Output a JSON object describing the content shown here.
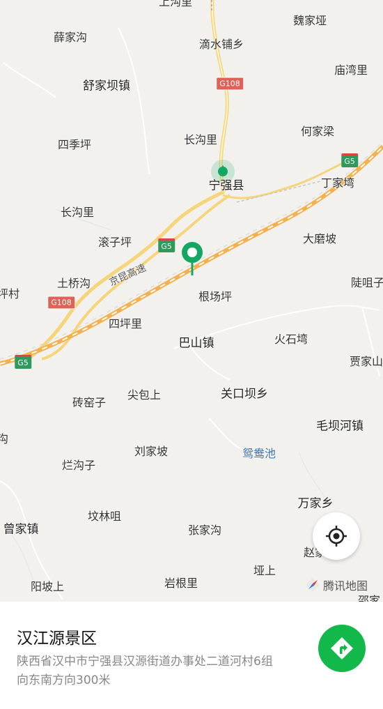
{
  "map": {
    "place_labels": [
      {
        "id": "shanggouli",
        "text": "上沟里"
      },
      {
        "id": "weijiaya",
        "text": "魏家垭"
      },
      {
        "id": "xuejiagou",
        "text": "薛家沟"
      },
      {
        "id": "dishuipu",
        "text": "滴水铺乡"
      },
      {
        "id": "miaowanli",
        "text": "庙湾里"
      },
      {
        "id": "shujiaba",
        "text": "舒家坝镇"
      },
      {
        "id": "hejialiang",
        "text": "何家梁"
      },
      {
        "id": "sijiping",
        "text": "四季坪"
      },
      {
        "id": "changgouli1",
        "text": "长沟里"
      },
      {
        "id": "ningqiang",
        "text": "宁强县"
      },
      {
        "id": "dingjiawan",
        "text": "丁家塆"
      },
      {
        "id": "changgouli2",
        "text": "长沟里"
      },
      {
        "id": "damopo",
        "text": "大磨坡"
      },
      {
        "id": "gunziping",
        "text": "滚子坪"
      },
      {
        "id": "tuqiaogou",
        "text": "土桥沟"
      },
      {
        "id": "pingcun",
        "text": "坪村"
      },
      {
        "id": "genchangping",
        "text": "根场坪"
      },
      {
        "id": "douzuzi",
        "text": "陡咀子"
      },
      {
        "id": "sipingli",
        "text": "四坪里"
      },
      {
        "id": "bashanzhen",
        "text": "巴山镇"
      },
      {
        "id": "huoshiwan",
        "text": "火石塆"
      },
      {
        "id": "jiajiashan",
        "text": "贾家山"
      },
      {
        "id": "zhuanyaozi",
        "text": "砖窑子"
      },
      {
        "id": "jianbaoshang",
        "text": "尖包上"
      },
      {
        "id": "guankouba",
        "text": "关口坝乡"
      },
      {
        "id": "gou",
        "text": "沟"
      },
      {
        "id": "maobahe",
        "text": "毛坝河镇"
      },
      {
        "id": "liujiapo",
        "text": "刘家坡"
      },
      {
        "id": "yuanyangchi",
        "text": "鸳鸯池"
      },
      {
        "id": "langouzi",
        "text": "烂沟子"
      },
      {
        "id": "wanjiaxiang",
        "text": "万家乡"
      },
      {
        "id": "fenlinju",
        "text": "坟林咀"
      },
      {
        "id": "zengjiazhen",
        "text": "曾家镇"
      },
      {
        "id": "zhangjiagou",
        "text": "张家沟"
      },
      {
        "id": "zhao",
        "text": "赵家"
      },
      {
        "id": "yashang",
        "text": "垭上"
      },
      {
        "id": "yangposhang",
        "text": "阳坡上"
      },
      {
        "id": "yangenli",
        "text": "岩根里"
      },
      {
        "id": "shaojia",
        "text": "邵家"
      }
    ],
    "road_shields": [
      {
        "id": "g108_top",
        "text": "G108"
      },
      {
        "id": "g5_right",
        "text": "G5"
      },
      {
        "id": "g5_mid",
        "text": "G5"
      },
      {
        "id": "g108_left",
        "text": "G108"
      },
      {
        "id": "g5_left",
        "text": "G5"
      }
    ],
    "highway_name": "京昆高速",
    "brand": "腾讯地图",
    "colors": {
      "land": "#f2f1ee",
      "road_yellow": "#f6d47a",
      "highway": "#f3b24e",
      "marker": "#12a864",
      "nav_button": "#12b94a"
    }
  },
  "poi": {
    "name": "汉江源景区",
    "address": "陕西省汉中市宁强县汉源街道办事处二道河村6组向东南方向300米"
  },
  "buttons": {
    "locate_icon": "crosshair-icon",
    "navigate_icon": "route-arrow-icon"
  }
}
